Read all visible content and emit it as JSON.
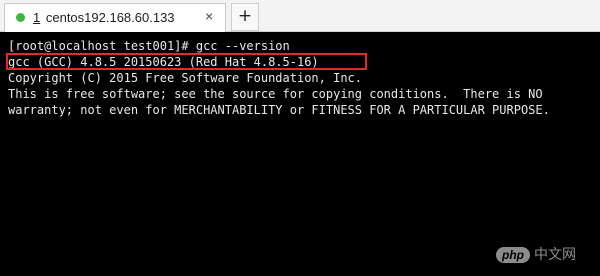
{
  "tab": {
    "number": "1",
    "title": "centos192.168.60.133",
    "close_glyph": "×",
    "status_color": "#3cb83c"
  },
  "new_tab_glyph": "+",
  "terminal": {
    "lines": [
      "[root@localhost test001]# gcc --version",
      "gcc (GCC) 4.8.5 20150623 (Red Hat 4.8.5-16)",
      "Copyright (C) 2015 Free Software Foundation, Inc.",
      "This is free software; see the source for copying conditions.  There is NO",
      "warranty; not even for MERCHANTABILITY or FITNESS FOR A PARTICULAR PURPOSE."
    ],
    "highlight_color": "#e12b2b"
  },
  "watermark": {
    "logo": "php",
    "text": "中文网"
  }
}
